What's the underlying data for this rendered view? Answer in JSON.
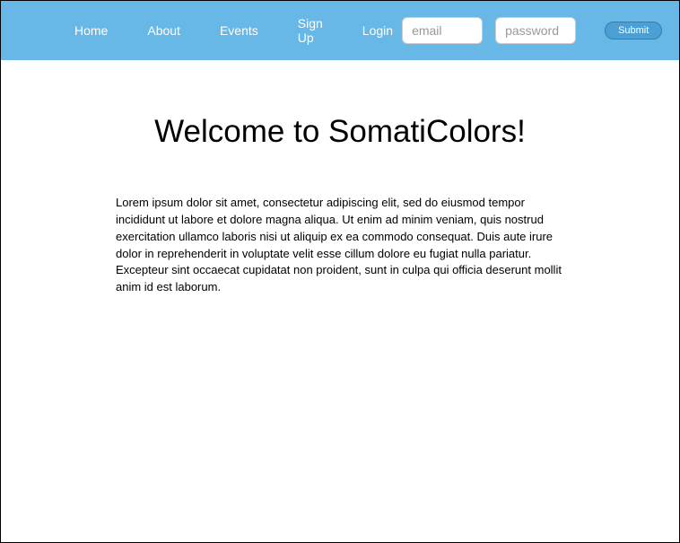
{
  "nav": {
    "home": "Home",
    "about": "About",
    "events": "Events",
    "signup": "Sign Up",
    "login": "Login"
  },
  "form": {
    "email_placeholder": "email",
    "password_placeholder": "password",
    "submit_label": "Submit"
  },
  "main": {
    "title": "Welcome to SomatiColors!",
    "body": "Lorem ipsum dolor sit amet, consectetur adipiscing elit, sed do eiusmod tempor incididunt ut labore et dolore magna aliqua. Ut enim ad minim veniam, quis nostrud exercitation ullamco laboris nisi ut aliquip ex ea commodo consequat. Duis aute irure dolor in reprehenderit in voluptate velit esse cillum dolore eu fugiat nulla pariatur. Excepteur sint occaecat cupidatat non proident, sunt in culpa qui officia deserunt mollit anim id est laborum."
  }
}
